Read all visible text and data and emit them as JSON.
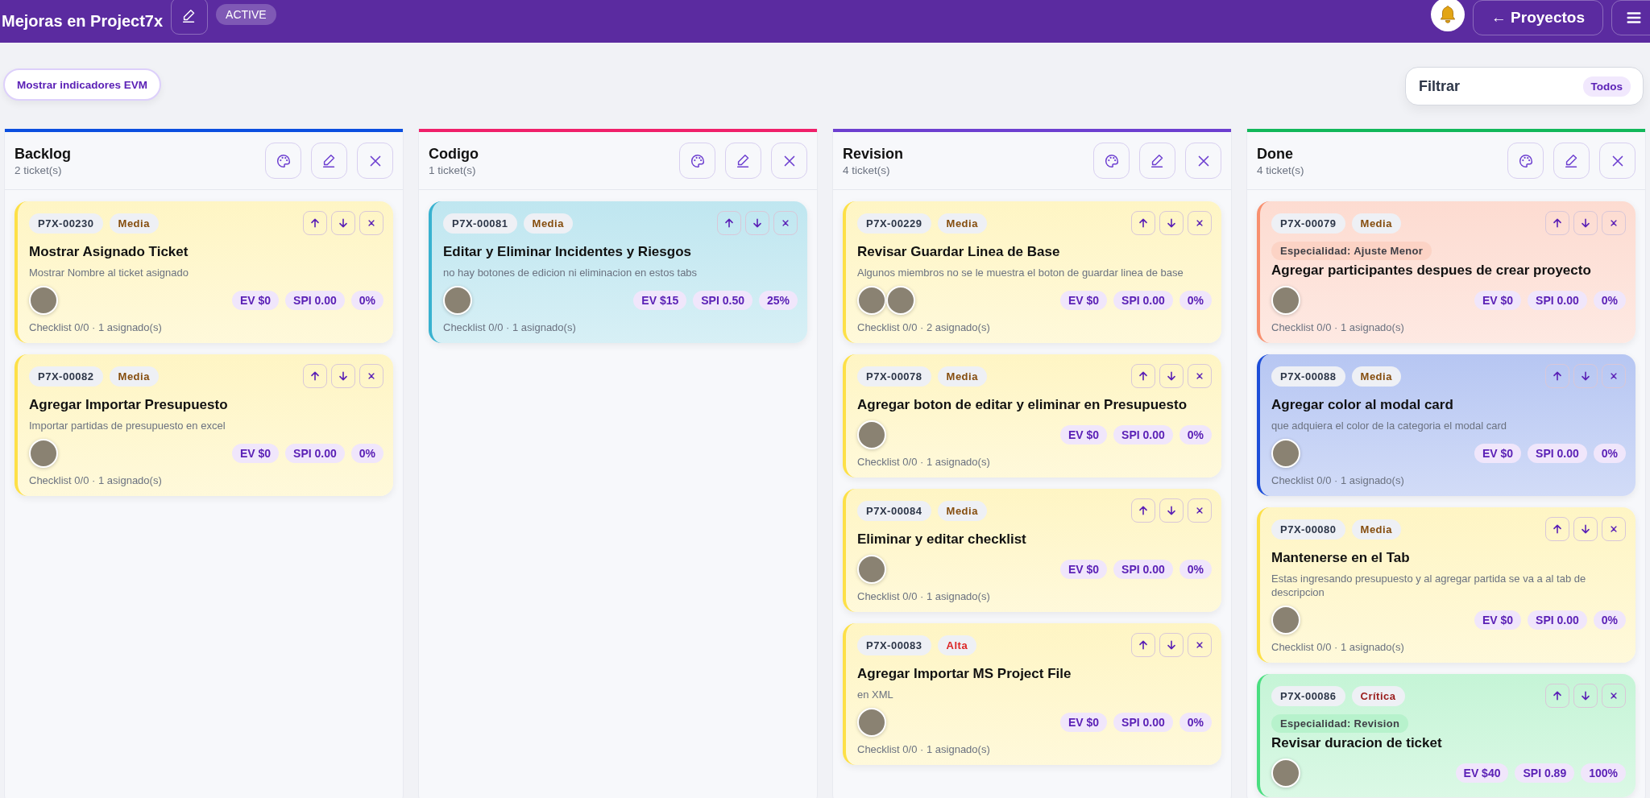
{
  "header": {
    "title": "Mejoras en Project7x",
    "status_badge": "ACTIVE",
    "back_button": "← Proyectos"
  },
  "toolbar": {
    "evm_button": "Mostrar indicadores EVM",
    "filter": {
      "label": "Filtrar",
      "value": "Todos"
    }
  },
  "columns": [
    {
      "title": "Backlog",
      "count": "2 ticket(s)",
      "color": "#0b4fe0",
      "cards": [
        {
          "id": "P7X-00230",
          "priority": {
            "label": "Media",
            "color": "#854d0e"
          },
          "color": "#fde047",
          "title": "Mostrar Asignado Ticket",
          "description": "Mostrar Nombre al ticket asignado",
          "avatars": [
            {
              "kind": "photo"
            }
          ],
          "ev": "EV $0",
          "spi": "SPI 0.00",
          "progress": "0%",
          "footer": "Checklist 0/0 · 1 asignado(s)"
        },
        {
          "id": "P7X-00082",
          "priority": {
            "label": "Media",
            "color": "#854d0e"
          },
          "color": "#fde047",
          "title": "Agregar Importar Presupuesto",
          "description": "Importar partidas de presupuesto en excel",
          "avatars": [
            {
              "kind": "photo"
            }
          ],
          "ev": "EV $0",
          "spi": "SPI 0.00",
          "progress": "0%",
          "footer": "Checklist 0/0 · 1 asignado(s)"
        }
      ]
    },
    {
      "title": "Codigo",
      "count": "1 ticket(s)",
      "color": "#f0206a",
      "cards": [
        {
          "id": "P7X-00081",
          "priority": {
            "label": "Media",
            "color": "#854d0e"
          },
          "color": "#38b2d0",
          "title": "Editar y Eliminar Incidentes y Riesgos",
          "description": "no hay botones de edicion ni eliminacion en estos tabs",
          "avatars": [
            {
              "kind": "photo"
            }
          ],
          "ev": "EV $15",
          "spi": "SPI 0.50",
          "progress": "25%",
          "footer": "Checklist 0/0 · 1 asignado(s)"
        }
      ]
    },
    {
      "title": "Revision",
      "count": "4 ticket(s)",
      "color": "#6d3fd0",
      "cards": [
        {
          "id": "P7X-00229",
          "priority": {
            "label": "Media",
            "color": "#854d0e"
          },
          "color": "#fde047",
          "title": "Revisar Guardar Linea de Base",
          "description": "Algunos miembros no se le muestra el boton de guardar linea de base",
          "avatars": [
            {
              "kind": "photo"
            },
            {
              "kind": "photo"
            }
          ],
          "ev": "EV $0",
          "spi": "SPI 0.00",
          "progress": "0%",
          "footer": "Checklist 0/0 · 2 asignado(s)"
        },
        {
          "id": "P7X-00078",
          "priority": {
            "label": "Media",
            "color": "#854d0e"
          },
          "color": "#fde047",
          "title": "Agregar boton de editar y eliminar en Presupuesto",
          "avatars": [
            {
              "kind": "photo"
            }
          ],
          "ev": "EV $0",
          "spi": "SPI 0.00",
          "progress": "0%",
          "footer": "Checklist 0/0 · 1 asignado(s)"
        },
        {
          "id": "P7X-00084",
          "priority": {
            "label": "Media",
            "color": "#854d0e"
          },
          "color": "#fde047",
          "title": "Eliminar y editar checklist",
          "avatars": [
            {
              "kind": "photo"
            }
          ],
          "ev": "EV $0",
          "spi": "SPI 0.00",
          "progress": "0%",
          "footer": "Checklist 0/0 · 1 asignado(s)"
        },
        {
          "id": "P7X-00083",
          "priority": {
            "label": "Alta",
            "color": "#dc2626"
          },
          "color": "#fde047",
          "title": "Agregar Importar MS Project File",
          "description": "en XML",
          "avatars": [
            {
              "kind": "photo"
            }
          ],
          "ev": "EV $0",
          "spi": "SPI 0.00",
          "progress": "0%",
          "footer": "Checklist 0/0 · 1 asignado(s)"
        }
      ]
    },
    {
      "title": "Done",
      "count": "4 ticket(s)",
      "color": "#12b85a",
      "cards": [
        {
          "id": "P7X-00079",
          "priority": {
            "label": "Media",
            "color": "#854d0e"
          },
          "color": "#f8906f",
          "specialty": "Especialidad: Ajuste Menor",
          "title": "Agregar participantes despues de crear proyecto",
          "avatars": [
            {
              "kind": "photo"
            }
          ],
          "ev": "EV $0",
          "spi": "SPI 0.00",
          "progress": "0%",
          "footer": "Checklist 0/0 · 1 asignado(s)"
        },
        {
          "id": "P7X-00088",
          "priority": {
            "label": "Media",
            "color": "#854d0e"
          },
          "color": "#1d4ed8",
          "title": "Agregar color al modal card",
          "description": "que adquiera el color de la categoria el modal card",
          "avatars": [
            {
              "kind": "photo"
            }
          ],
          "ev": "EV $0",
          "spi": "SPI 0.00",
          "progress": "0%",
          "footer": "Checklist 0/0 · 1 asignado(s)"
        },
        {
          "id": "P7X-00080",
          "priority": {
            "label": "Media",
            "color": "#854d0e"
          },
          "color": "#fde047",
          "title": "Mantenerse en el Tab",
          "description": "Estas ingresando presupuesto y al agregar partida se va a al tab de descripcion",
          "avatars": [
            {
              "kind": "photo"
            }
          ],
          "ev": "EV $0",
          "spi": "SPI 0.00",
          "progress": "0%",
          "footer": "Checklist 0/0 · 1 asignado(s)"
        },
        {
          "id": "P7X-00086",
          "priority": {
            "label": "Crítica",
            "color": "#991b1b"
          },
          "color": "#4ade80",
          "specialty": "Especialidad: Revision",
          "title": "Revisar duracion de ticket",
          "avatars": [
            {
              "kind": "photo"
            }
          ],
          "ev": "EV $40",
          "spi": "SPI 0.89",
          "progress": "100%"
        }
      ]
    }
  ]
}
